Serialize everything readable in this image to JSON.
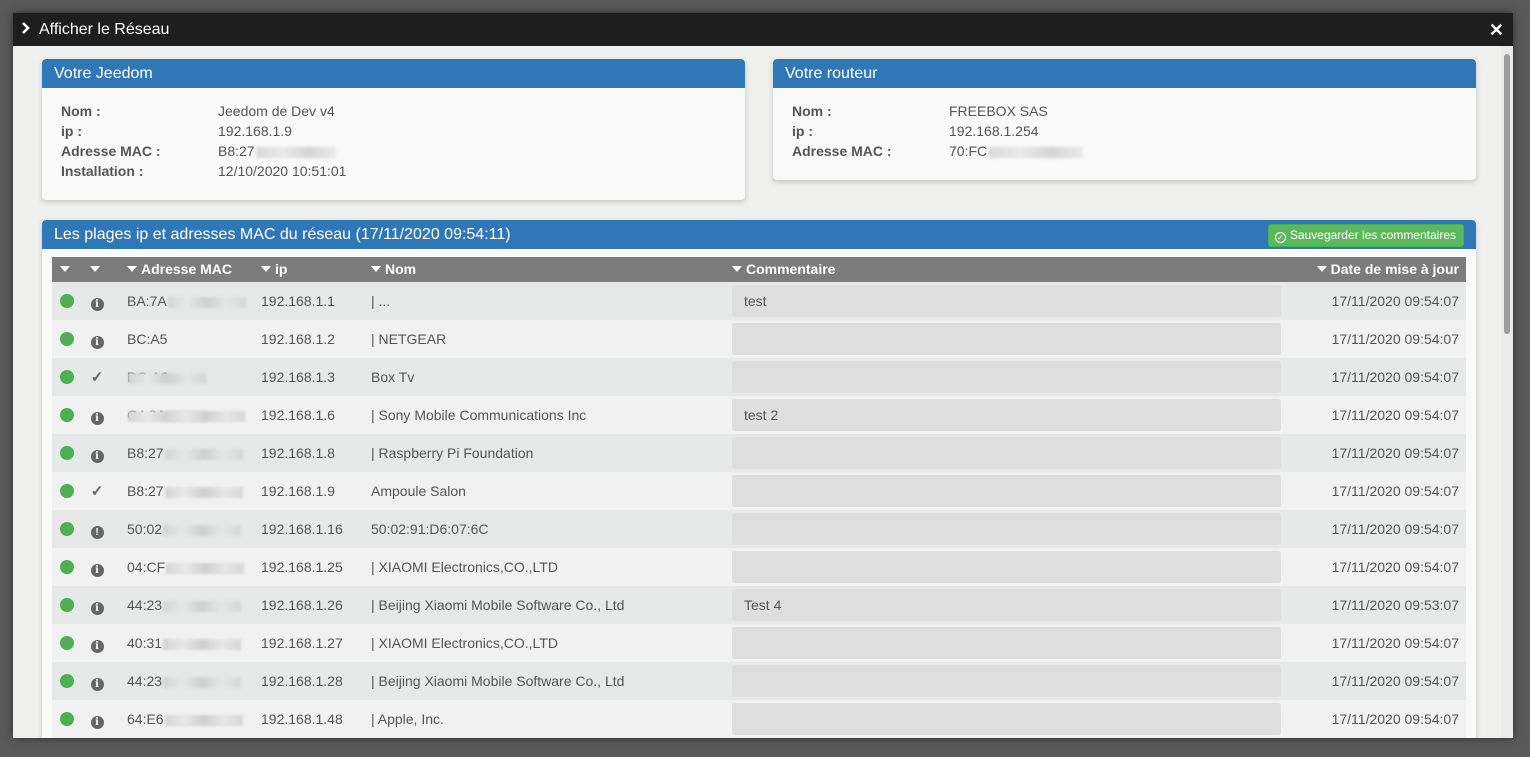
{
  "modal": {
    "title": "Afficher le Réseau"
  },
  "jeedom": {
    "title": "Votre Jeedom",
    "fields": [
      {
        "label": "Nom :",
        "value": "Jeedom de Dev v4"
      },
      {
        "label": "ip :",
        "value": "192.168.1.9"
      },
      {
        "label": "Adresse MAC :",
        "value": "B8:27",
        "blurred": true
      },
      {
        "label": "Installation :",
        "value": "12/10/2020 10:51:01"
      }
    ]
  },
  "router": {
    "title": "Votre routeur",
    "fields": [
      {
        "label": "Nom :",
        "value": "FREEBOX SAS"
      },
      {
        "label": "ip :",
        "value": "192.168.1.254"
      },
      {
        "label": "Adresse MAC :",
        "value": "70:FC",
        "blurred": true
      }
    ]
  },
  "network": {
    "title": "Les plages ip et adresses MAC du réseau (17/11/2020 09:54:11)",
    "save_label": "Sauvegarder les commentaires",
    "headers": [
      "",
      "",
      "Adresse MAC",
      "ip",
      "Nom",
      "Commentaire",
      "Date de mise à jour"
    ],
    "rows": [
      {
        "status": "online",
        "icon": "info",
        "mac": "BA:7A",
        "ip": "192.168.1.1",
        "name": "| ...",
        "comment": "test",
        "date": "17/11/2020 09:54:07"
      },
      {
        "status": "online",
        "icon": "info",
        "mac": "BC:A5",
        "ip": "192.168.1.2",
        "name": "| NETGEAR",
        "comment": "",
        "date": "17/11/2020 09:54:07"
      },
      {
        "status": "online",
        "icon": "check",
        "mac": "DC:A6",
        "ip": "192.168.1.3",
        "name": "Box Tv",
        "comment": "",
        "date": "17/11/2020 09:54:07"
      },
      {
        "status": "online",
        "icon": "info",
        "mac": "C4:3A",
        "ip": "192.168.1.6",
        "name": "| Sony Mobile Communications Inc",
        "comment": "test 2",
        "date": "17/11/2020 09:54:07"
      },
      {
        "status": "online",
        "icon": "info",
        "mac": "B8:27",
        "ip": "192.168.1.8",
        "name": "| Raspberry Pi Foundation",
        "comment": "",
        "date": "17/11/2020 09:54:07"
      },
      {
        "status": "online",
        "icon": "check",
        "mac": "B8:27",
        "ip": "192.168.1.9",
        "name": "Ampoule Salon",
        "comment": "",
        "date": "17/11/2020 09:54:07"
      },
      {
        "status": "online",
        "icon": "warning",
        "mac": "50:02",
        "ip": "192.168.1.16",
        "name": "50:02:91:D6:07:6C",
        "comment": "",
        "date": "17/11/2020 09:54:07"
      },
      {
        "status": "online",
        "icon": "info",
        "mac": "04:CF",
        "ip": "192.168.1.25",
        "name": "| XIAOMI Electronics,CO.,LTD",
        "comment": "",
        "date": "17/11/2020 09:54:07"
      },
      {
        "status": "online",
        "icon": "info",
        "mac": "44:23",
        "ip": "192.168.1.26",
        "name": "| Beijing Xiaomi Mobile Software Co., Ltd",
        "comment": "Test 4",
        "date": "17/11/2020 09:53:07"
      },
      {
        "status": "online",
        "icon": "info",
        "mac": "40:31",
        "ip": "192.168.1.27",
        "name": "| XIAOMI Electronics,CO.,LTD",
        "comment": "",
        "date": "17/11/2020 09:54:07"
      },
      {
        "status": "online",
        "icon": "info",
        "mac": "44:23",
        "ip": "192.168.1.28",
        "name": "| Beijing Xiaomi Mobile Software Co., Ltd",
        "comment": "",
        "date": "17/11/2020 09:54:07"
      },
      {
        "status": "online",
        "icon": "info",
        "mac": "64:E6",
        "ip": "192.168.1.48",
        "name": "| Apple, Inc.",
        "comment": "",
        "date": "17/11/2020 09:54:07"
      }
    ]
  },
  "colors": {
    "accent": "#2f77b7",
    "online": "#4db050",
    "save": "#5cb85c",
    "titlebar": "#1e1e1e",
    "table_header": "#7c7c7c"
  }
}
